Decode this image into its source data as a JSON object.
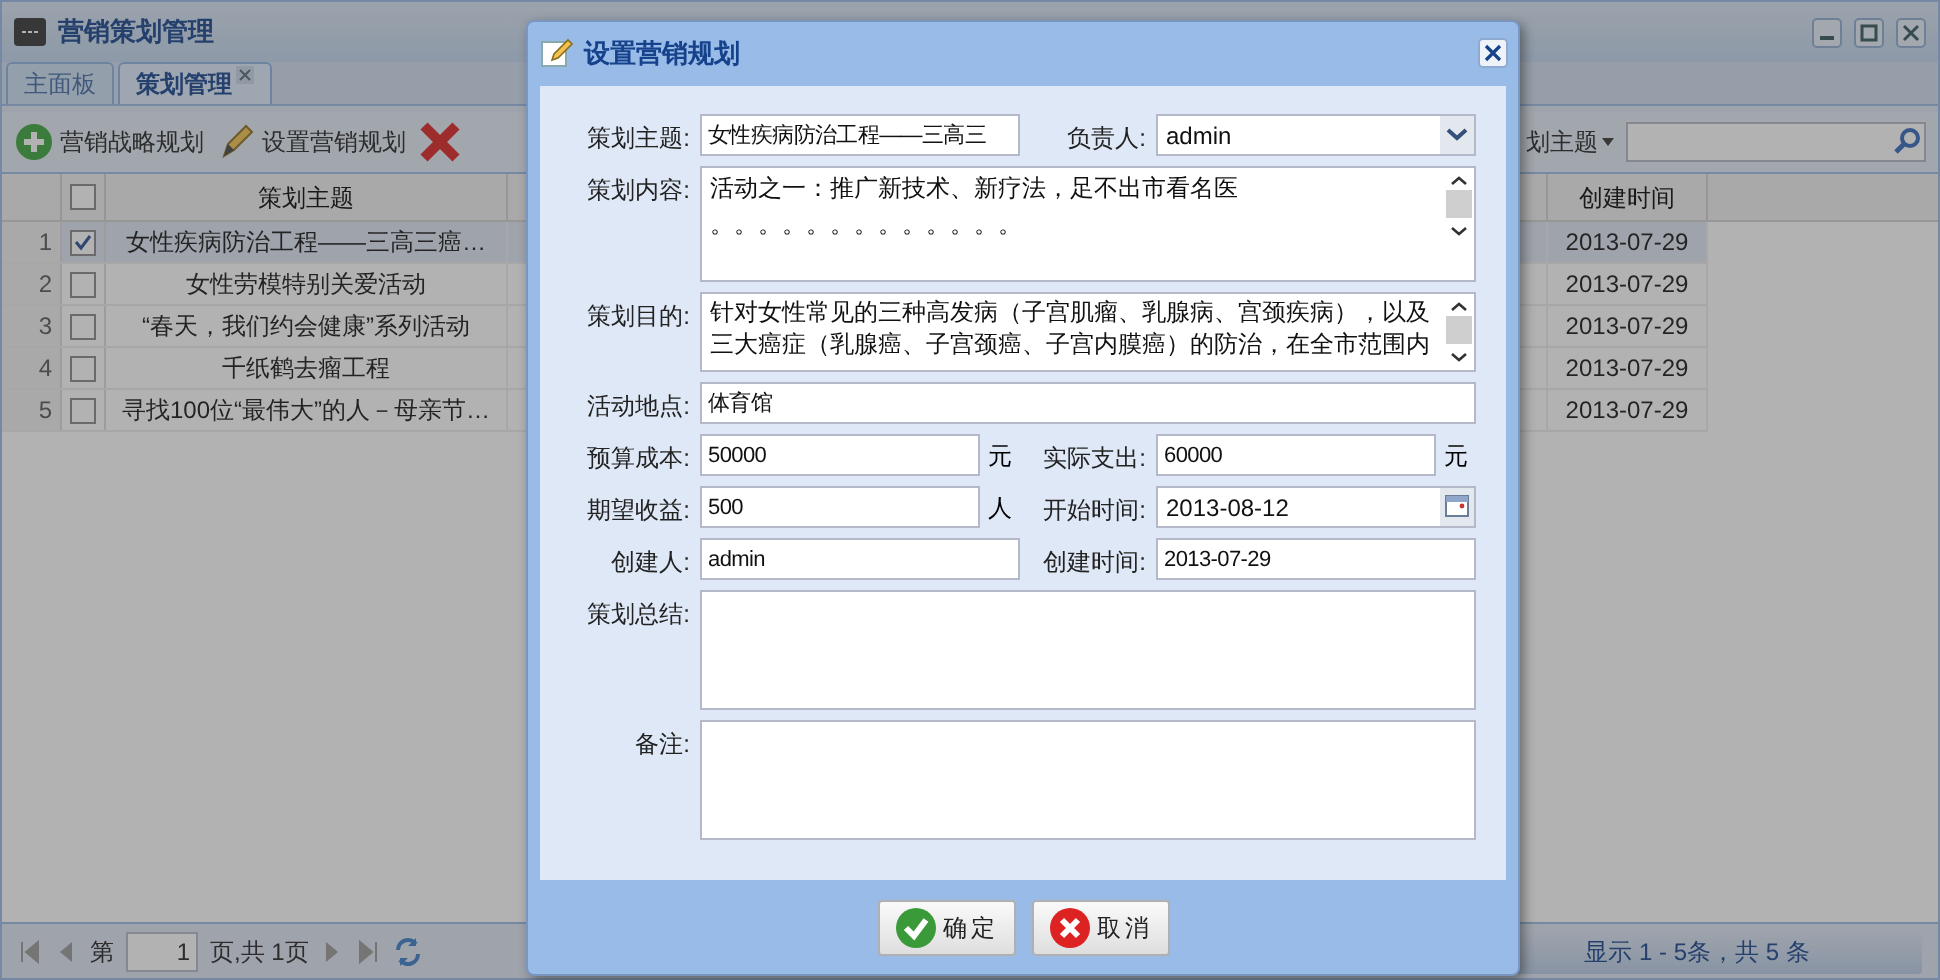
{
  "window": {
    "title": "营销策划管理"
  },
  "tabs": [
    {
      "label": "主面板",
      "selected": false,
      "closable": false
    },
    {
      "label": "策划管理",
      "selected": true,
      "closable": true
    }
  ],
  "toolbar": {
    "buttons": [
      {
        "kind": "add",
        "label": "营销战略规划"
      },
      {
        "kind": "edit",
        "label": "设置营销规划"
      },
      {
        "kind": "delete"
      }
    ],
    "filter": "划主题"
  },
  "table": {
    "header_checked": false,
    "columns": [
      "策划主题",
      "创建时间"
    ],
    "rows": [
      {
        "index": "1",
        "selected": true,
        "topic": "女性疾病防治工程——三高三癌…",
        "created": "2013-07-29"
      },
      {
        "index": "2",
        "selected": false,
        "topic": "女性劳模特别关爱活动",
        "created": "2013-07-29"
      },
      {
        "index": "3",
        "selected": false,
        "topic": "“春天，我们约会健康”系列活动",
        "created": "2013-07-29"
      },
      {
        "index": "4",
        "selected": false,
        "topic": "千纸鹤去瘤工程",
        "created": "2013-07-29"
      },
      {
        "index": "5",
        "selected": false,
        "topic": "寻找100位“最伟大”的人－母亲节…",
        "created": "2013-07-29"
      }
    ]
  },
  "pager": {
    "before": "第",
    "page": "1",
    "after": "页,共 1页",
    "summary": "显示 1 - 5条，共 5 条"
  },
  "dialog": {
    "title": "设置营销规划",
    "rows": [
      [
        {
          "kind": "text",
          "label": "策划主题:",
          "value": "女性疾病防治工程——三高三"
        },
        {
          "kind": "select",
          "label": "负责人:",
          "value": "admin"
        }
      ],
      [
        {
          "kind": "textarea",
          "label": "策划内容:",
          "lines": [
            "活动之一：推广新技术、新疗法，足不出市看名医",
            "。。。。。。。。。。。。。"
          ]
        }
      ],
      [
        {
          "kind": "textarea",
          "label": "策划目的:",
          "value": "针对女性常见的三种高发病（子宫肌瘤、乳腺病、宫颈疾病），以及三大癌症（乳腺癌、子宫颈癌、子宫内膜癌）的防治，在全市范围内"
        }
      ],
      [
        {
          "kind": "text",
          "label": "活动地点:",
          "value": "体育馆"
        }
      ],
      [
        {
          "kind": "text",
          "label": "预算成本:",
          "value": "50000",
          "unit": "元"
        },
        {
          "kind": "text",
          "label": "实际支出:",
          "value": "60000",
          "unit": "元"
        }
      ],
      [
        {
          "kind": "text",
          "label": "期望收益:",
          "value": "500",
          "unit": "人"
        },
        {
          "kind": "date",
          "label": "开始时间:",
          "value": "2013-08-12"
        }
      ],
      [
        {
          "kind": "text",
          "label": "创建人:",
          "value": "admin"
        },
        {
          "kind": "text",
          "label": "创建时间:",
          "value": "2013-07-29"
        }
      ],
      [
        {
          "kind": "textarea",
          "label": "策划总结:"
        }
      ],
      [
        {
          "kind": "textarea",
          "label": "备注:"
        }
      ]
    ],
    "buttons": [
      {
        "kind": "ok",
        "label": "确定"
      },
      {
        "kind": "cancel",
        "label": "取消"
      }
    ]
  }
}
